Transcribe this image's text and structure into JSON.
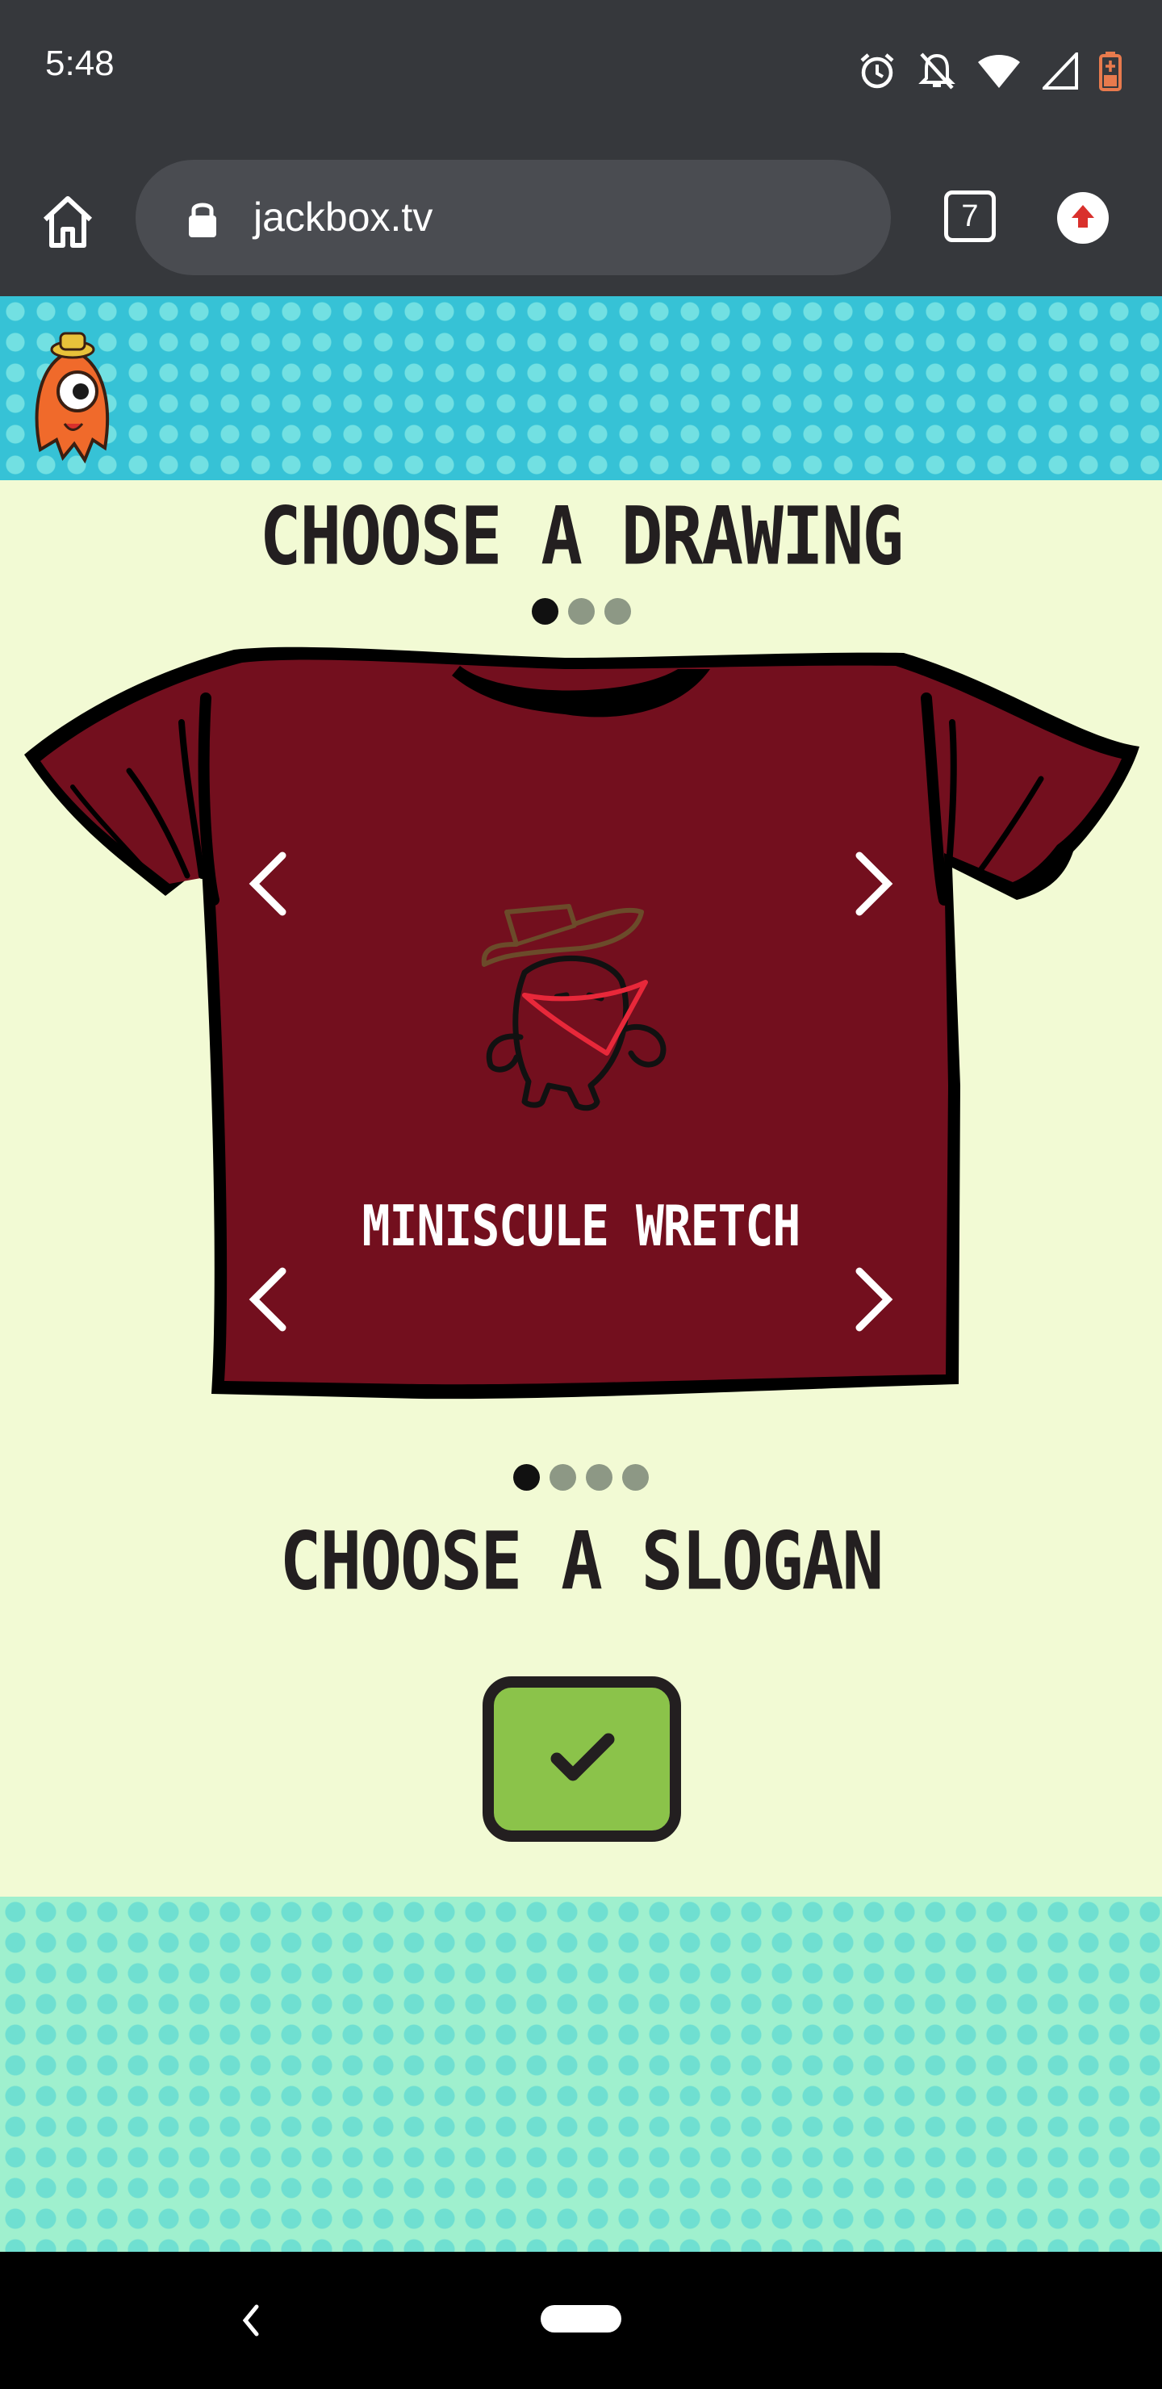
{
  "status_bar": {
    "time": "5:48",
    "icons": [
      "alarm-icon",
      "notifications-off-icon",
      "wifi-icon",
      "signal-icon",
      "battery-icon"
    ]
  },
  "browser": {
    "url": "jackbox.tv",
    "tab_count": "7"
  },
  "game": {
    "drawing_heading": "CHOOSE A DRAWING",
    "drawing_page_count": 3,
    "drawing_active_index": 0,
    "slogan": "MINISCULE WRETCH",
    "slogan_heading": "CHOOSE A SLOGAN",
    "slogan_page_count": 4,
    "slogan_active_index": 0,
    "confirm_icon": "check-icon"
  },
  "colors": {
    "shirt": "#730f1e",
    "accent_green": "#8bc34a",
    "header_blue": "#36c2d6",
    "background": "#f2fad4"
  }
}
